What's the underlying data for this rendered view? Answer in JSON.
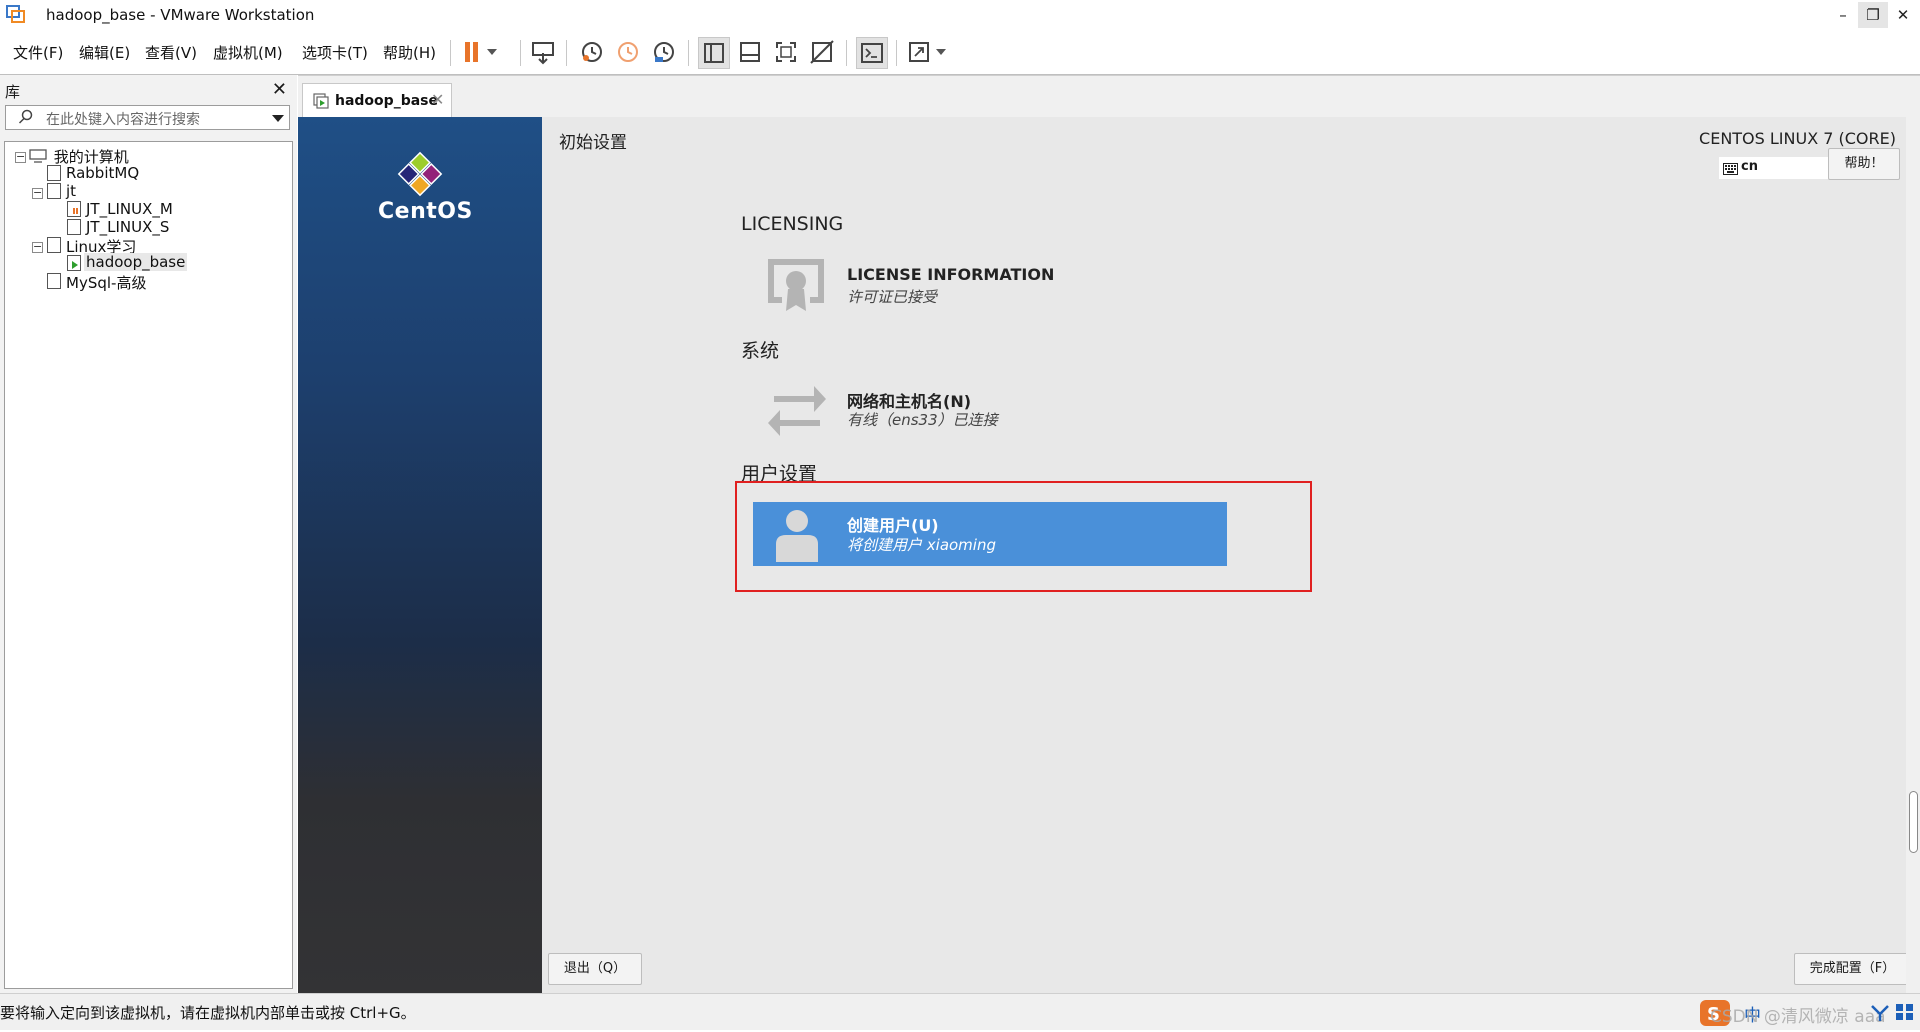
{
  "window": {
    "title": "hadoop_base - VMware Workstation",
    "minimize": "–",
    "restore": "❐",
    "close": "✕"
  },
  "menu": {
    "items": [
      "文件(F)",
      "编辑(E)",
      "查看(V)",
      "虚拟机(M)",
      "选项卡(T)",
      "帮助(H)"
    ]
  },
  "toolbar": {
    "icons": [
      "pause-icon",
      "send-ctrl-alt-del-icon",
      "snapshot-icon",
      "revert-snapshot-icon",
      "snapshot-manager-icon",
      "library-view-icon",
      "thumbnail-bar-icon",
      "full-screen-icon",
      "unity-icon",
      "console-view-icon",
      "stretch-guest-icon"
    ]
  },
  "library": {
    "title": "库",
    "close": "✕",
    "search_placeholder": "在此处键入内容进行搜索",
    "tree": {
      "root": "我的计算机",
      "rabbitmq": "RabbitMQ",
      "jt": "jt",
      "jt_m": "JT_LINUX_M",
      "jt_s": "JT_LINUX_S",
      "linux": "Linux学习",
      "hadoop": "hadoop_base",
      "mysql": "MySql-高级"
    }
  },
  "tab": {
    "label": "hadoop_base",
    "close": "✕"
  },
  "guest": {
    "brand": "CentOS",
    "header_title": "初始设置",
    "os_name": "CENTOS LINUX 7 (CORE)",
    "keyboard_layout": "cn",
    "help_button": "帮助！",
    "sections": {
      "licensing": "LICENSING",
      "system": "系统",
      "user": "用户设置"
    },
    "spokes": {
      "license_title": "LICENSE INFORMATION",
      "license_status": "许可证已接受",
      "network_title": "网络和主机名(N)",
      "network_status": "有线（ens33）已连接",
      "user_title": "创建用户(U)",
      "user_status": "将创建用户 xiaoming"
    },
    "quit_button": "退出（Q）",
    "finish_button": "完成配置（F）"
  },
  "statusbar": {
    "hint": "要将输入定向到该虚拟机，请在虚拟机内部单击或按 Ctrl+G。",
    "ime": "中",
    "watermark": "CSDN @清风微凉 aaa"
  },
  "colors": {
    "selected_spoke": "#4a90d9",
    "annotation_box": "#e02020",
    "sidebar_top": "#1f4f86",
    "pause_orange": "#e8742a"
  }
}
